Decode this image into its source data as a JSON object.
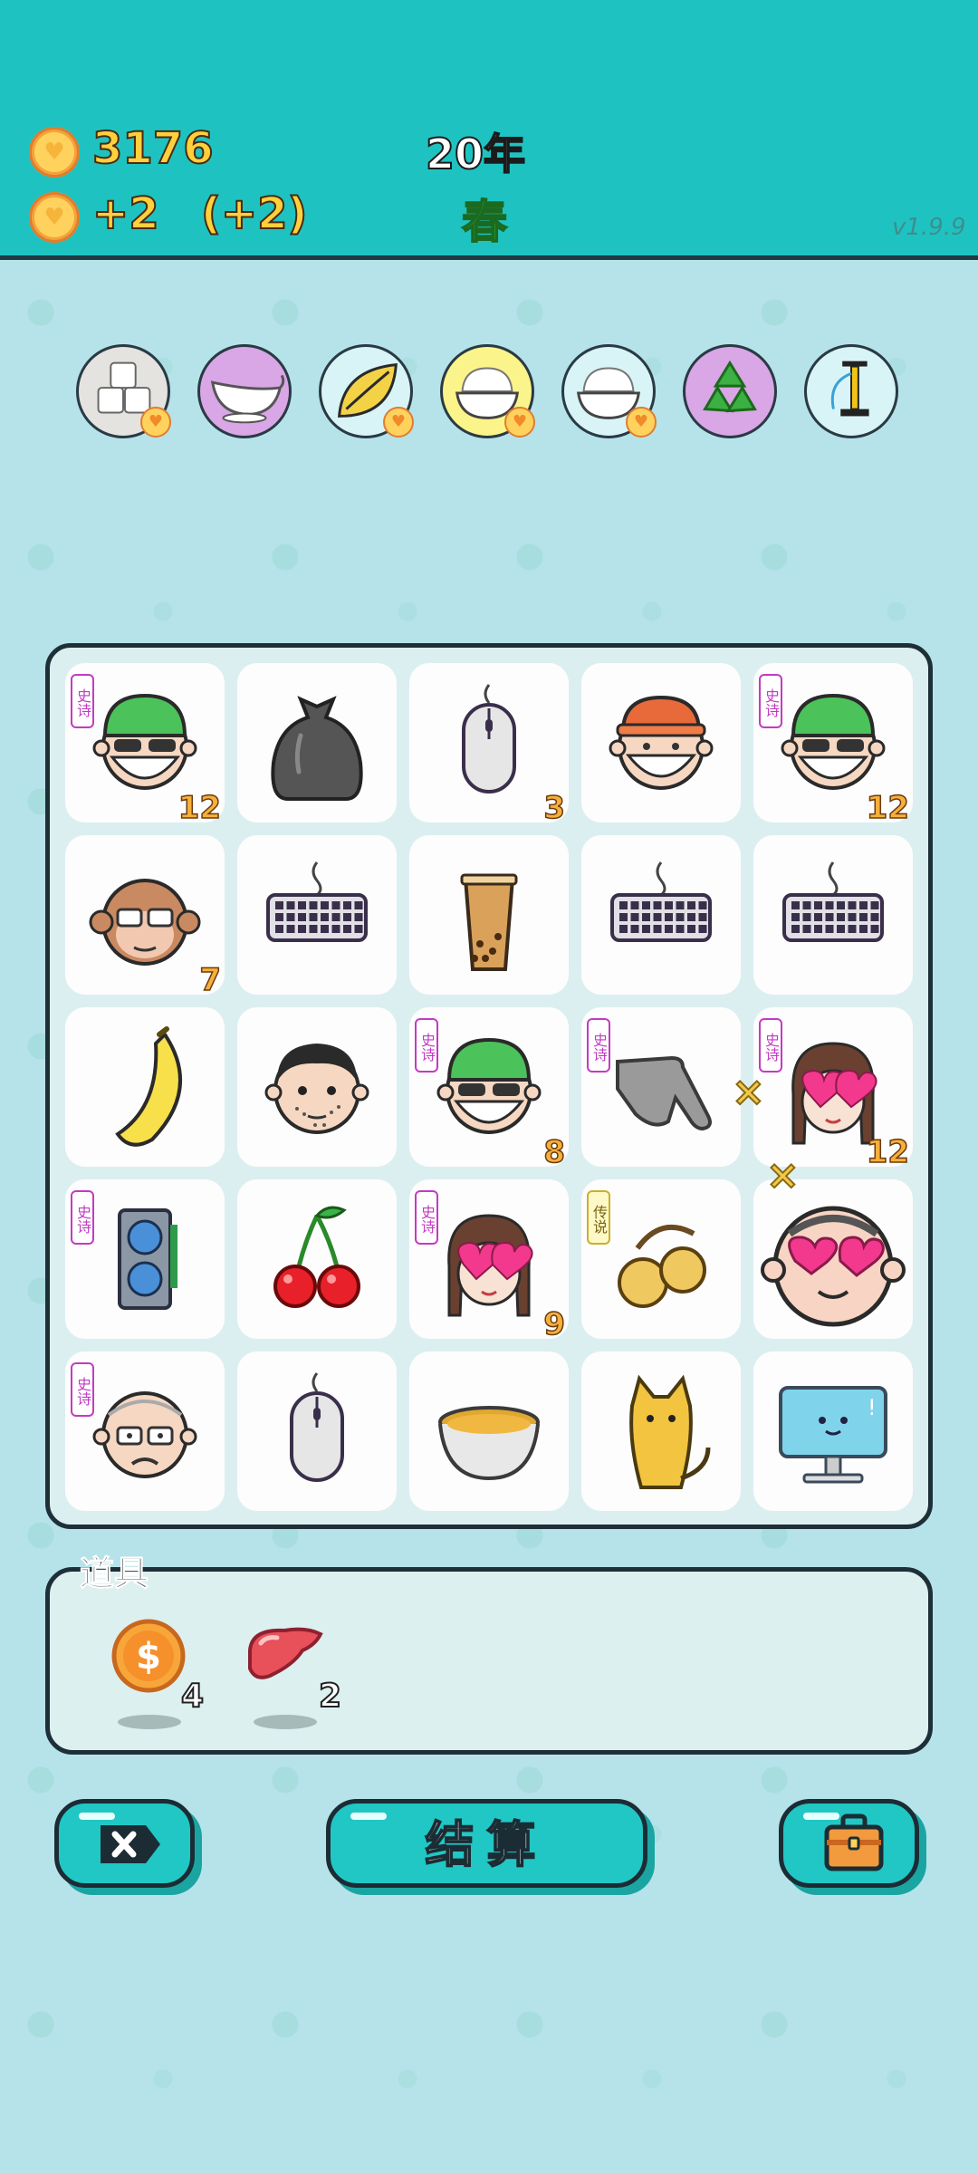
{
  "header": {
    "gold_total": "3176",
    "gold_per_turn": "+2",
    "gold_bonus": "(+2)",
    "year": "20年",
    "season": "春",
    "version": "v1.9.9"
  },
  "buffs": [
    {
      "icon": "sugar-cubes-icon",
      "color": "#e4e3df",
      "heart": true
    },
    {
      "icon": "gravy-boat-icon",
      "color": "#d9a6e6",
      "heart": false
    },
    {
      "icon": "leaf-icon",
      "color": "#d8f4f6",
      "heart": true
    },
    {
      "icon": "rice-bowl-icon",
      "color": "#fbf48a",
      "heart": true
    },
    {
      "icon": "rice-bowl-icon",
      "color": "#d8f4f6",
      "heart": true
    },
    {
      "icon": "recycle-icon",
      "color": "#d9a6e6",
      "heart": false
    },
    {
      "icon": "air-pump-icon",
      "color": "#d8f4f6",
      "heart": false
    }
  ],
  "board": {
    "rows": [
      [
        {
          "icon": "green-cap-masked-man-icon",
          "tag": "史诗",
          "count": "12"
        },
        {
          "icon": "garbage-bag-icon",
          "tag": "",
          "count": ""
        },
        {
          "icon": "computer-mouse-icon",
          "tag": "",
          "count": "3"
        },
        {
          "icon": "orange-cap-masked-man-icon",
          "tag": "",
          "count": ""
        },
        {
          "icon": "green-cap-masked-man-icon",
          "tag": "史诗",
          "count": "12"
        }
      ],
      [
        {
          "icon": "monkey-with-glasses-icon",
          "tag": "",
          "count": "7"
        },
        {
          "icon": "keyboard-icon",
          "tag": "",
          "count": ""
        },
        {
          "icon": "bubble-tea-cup-icon",
          "tag": "",
          "count": ""
        },
        {
          "icon": "keyboard-icon",
          "tag": "",
          "count": ""
        },
        {
          "icon": "keyboard-icon",
          "tag": "",
          "count": ""
        }
      ],
      [
        {
          "icon": "banana-icon",
          "tag": "",
          "count": ""
        },
        {
          "icon": "stubble-man-face-icon",
          "tag": "",
          "count": ""
        },
        {
          "icon": "green-cap-masked-man-icon",
          "tag": "史诗",
          "count": "8"
        },
        {
          "icon": "pointing-hand-icon",
          "tag": "史诗",
          "count": ""
        },
        {
          "icon": "heart-eyes-girl-icon",
          "tag": "史诗",
          "count": "12"
        }
      ],
      [
        {
          "icon": "graphics-card-icon",
          "tag": "史诗",
          "count": ""
        },
        {
          "icon": "cherries-icon",
          "tag": "",
          "count": ""
        },
        {
          "icon": "heart-eyes-girl-icon",
          "tag": "史诗",
          "count": "9"
        },
        {
          "icon": "longan-fruit-icon",
          "tag": "传说",
          "count": ""
        },
        {
          "icon": "heart-eyes-bald-man-icon",
          "tag": "",
          "count": ""
        }
      ],
      [
        {
          "icon": "worried-bald-man-icon",
          "tag": "史诗",
          "count": ""
        },
        {
          "icon": "computer-mouse-icon",
          "tag": "",
          "count": ""
        },
        {
          "icon": "soup-bowl-icon",
          "tag": "",
          "count": ""
        },
        {
          "icon": "yellow-cat-icon",
          "tag": "",
          "count": ""
        },
        {
          "icon": "computer-monitor-icon",
          "tag": "",
          "count": ""
        }
      ]
    ]
  },
  "props": {
    "title": "道具",
    "items": [
      {
        "icon": "dollar-coin-icon",
        "count": "4"
      },
      {
        "icon": "liver-icon",
        "count": "2"
      }
    ]
  },
  "buttons": {
    "delete_icon": "delete-x-icon",
    "settle_label": "结算",
    "bag_icon": "briefcase-icon"
  }
}
